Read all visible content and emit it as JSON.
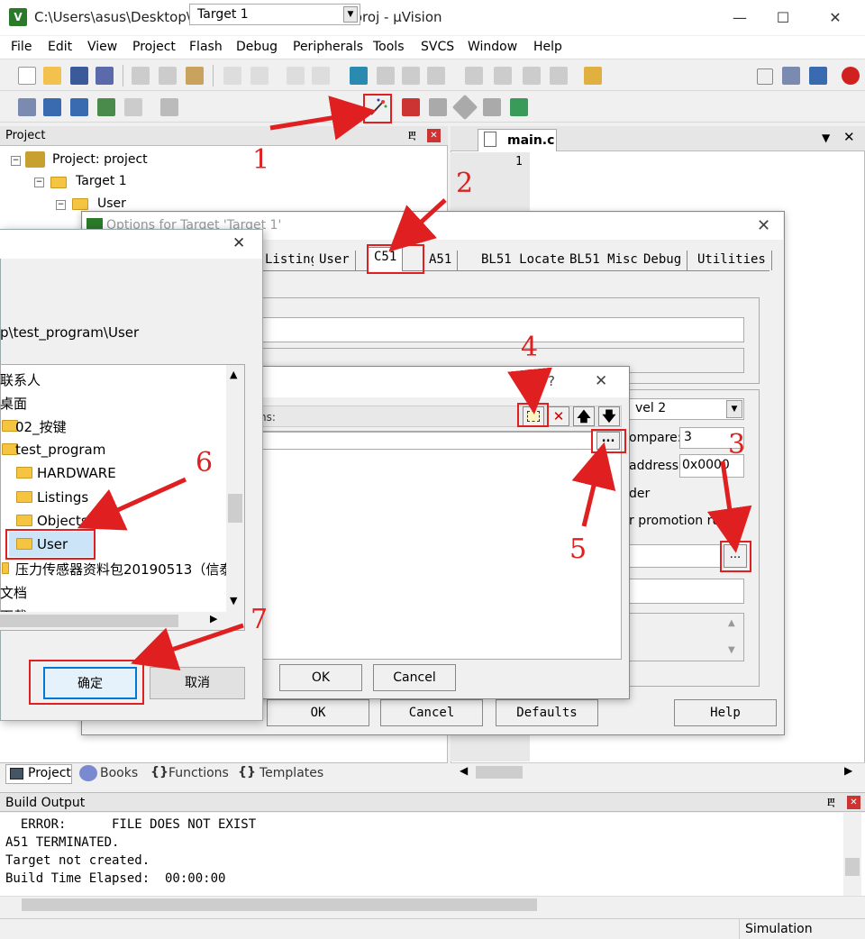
{
  "window": {
    "title": "C:\\Users\\asus\\Desktop\\test_program\\project.uvproj - µVision",
    "icon_letter": "V"
  },
  "menu": [
    "File",
    "Edit",
    "View",
    "Project",
    "Flash",
    "Debug",
    "Peripherals",
    "Tools",
    "SVCS",
    "Window",
    "Help"
  ],
  "toolbar": {
    "target": "Target 1"
  },
  "project_pane": {
    "title": "Project",
    "root": "Project: project",
    "target": "Target 1",
    "group": "User"
  },
  "editor": {
    "tab": "main.c",
    "line_no": "1"
  },
  "bottom_tabs": [
    "Project",
    "Books",
    "Functions",
    "Templates"
  ],
  "build_output": {
    "title": "Build Output",
    "lines": [
      "  ERROR:      FILE DOES NOT EXIST",
      "A51 TERMINATED.",
      "Target not created.",
      "Build Time Elapsed:  00:00:00"
    ]
  },
  "status": {
    "mode": "Simulation"
  },
  "options_dialog": {
    "title": "Options for Target 'Target 1'",
    "tabs": [
      "Listing",
      "User",
      "C51",
      "A51",
      "BL51 Locate",
      "BL51 Misc",
      "Debug",
      "Utilities"
    ],
    "level_value": "vel 2",
    "compare_label": "ompare:",
    "compare_value": "3",
    "address_label": "address:",
    "address_value": "0x0000",
    "order_label": "der",
    "promotion_label": "r promotion rules",
    "browse_btn": "...",
    "buttons": {
      "ok": "OK",
      "cancel": "Cancel",
      "defaults": "Defaults",
      "help": "Help"
    }
  },
  "include_dialog": {
    "help": "?",
    "paths_label": "hs:",
    "browse_btn": "...",
    "ok": "OK",
    "cancel": "Cancel"
  },
  "browse_dialog": {
    "path": "p\\test_program\\User",
    "items": [
      "联系人",
      "桌面",
      "02_按键",
      "test_program",
      "HARDWARE",
      "Listings",
      "Objects",
      "User",
      "压力传感器资料包20190513（信泰",
      "文档",
      "下载"
    ],
    "ok": "确定",
    "cancel": "取消"
  },
  "annotations": [
    "1",
    "2",
    "3",
    "4",
    "5",
    "6",
    "7"
  ]
}
